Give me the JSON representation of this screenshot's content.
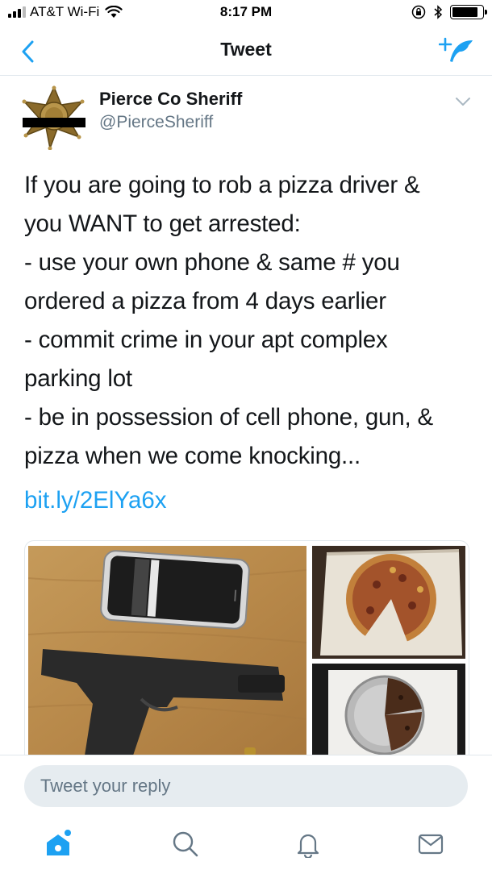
{
  "status_bar": {
    "carrier": "AT&T Wi-Fi",
    "time": "8:17 PM"
  },
  "nav": {
    "title": "Tweet"
  },
  "tweet": {
    "author_name": "Pierce Co Sheriff",
    "author_handle": "@PierceSheriff",
    "text_lines": [
      "If you are going to rob a pizza driver &",
      "you WANT to get arrested:",
      "- use your own phone & same # you",
      "ordered a pizza from 4 days earlier",
      "- commit crime in your apt complex",
      "parking lot",
      "- be in possession of cell phone, gun, &",
      "pizza when we come knocking..."
    ],
    "link": "bit.ly/2ElYa6x"
  },
  "reply": {
    "placeholder": "Tweet your reply"
  },
  "tabs": [
    "home-icon",
    "search-icon",
    "notifications-icon",
    "messages-icon"
  ],
  "colors": {
    "accent": "#1da1f2",
    "text": "#14171a",
    "secondary": "#657786",
    "reply_bg": "#e6ecf0"
  }
}
